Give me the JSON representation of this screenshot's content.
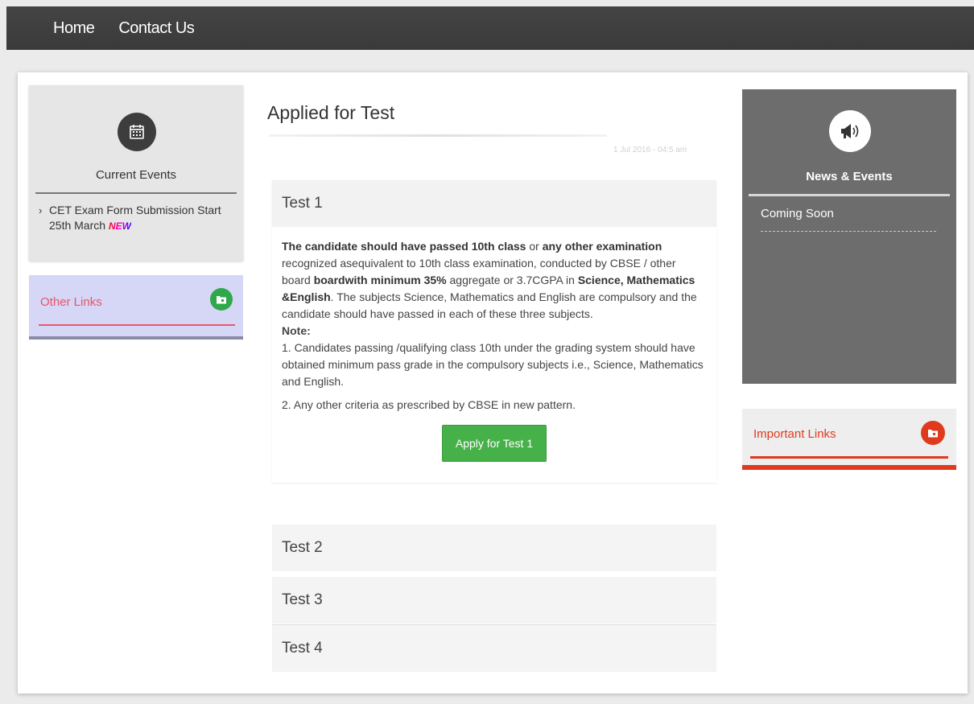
{
  "nav": {
    "home": "Home",
    "contact": "Contact Us"
  },
  "left": {
    "events_title": "Current Events",
    "events_item": "CET Exam Form Submission Start 25th March",
    "new_badge": "NEW",
    "other_links": "Other Links"
  },
  "main": {
    "title": "Applied for Test",
    "date": "1 Jul 2016 - 04:5 am",
    "tests": [
      {
        "label": "Test 1"
      },
      {
        "label": "Test 2"
      },
      {
        "label": "Test 3"
      },
      {
        "label": "Test 4"
      }
    ],
    "body": {
      "p1_b1": "The candidate should have passed 10th class",
      "p1_t1": " or ",
      "p1_b2": "any other examination",
      "p1_t2": " recognized asequivalent to 10th class examination, conducted by CBSE / other board ",
      "p1_b3": "boardwith minimum 35%",
      "p1_t3": " aggregate or 3.7CGPA in ",
      "p1_b4": "Science, Mathematics &English",
      "p1_t4": ". The subjects Science, Mathematics and English are compulsory and the candidate should have passed in each of these three subjects.",
      "note_title": "Note:",
      "note1": "1. Candidates passing /qualifying class 10th under the grading system should have obtained minimum pass grade in the compulsory subjects i.e., Science, Mathematics and English.",
      "note2": "2. Any other criteria as prescribed by CBSE in new pattern."
    },
    "apply_label": "Apply for Test 1"
  },
  "right": {
    "news_title": "News & Events",
    "news_item": "Coming Soon",
    "important_links": "Important Links"
  },
  "colors": {
    "nav_bg": "#3f3f3f",
    "apply_green": "#46b149",
    "other_links_red": "#e8556a",
    "important_red": "#e03a1e",
    "news_bg": "#6d6d6d"
  },
  "icons": {
    "events": "calendar-icon",
    "news": "megaphone-icon",
    "other_links": "folder-icon",
    "important_links": "folder-icon"
  }
}
